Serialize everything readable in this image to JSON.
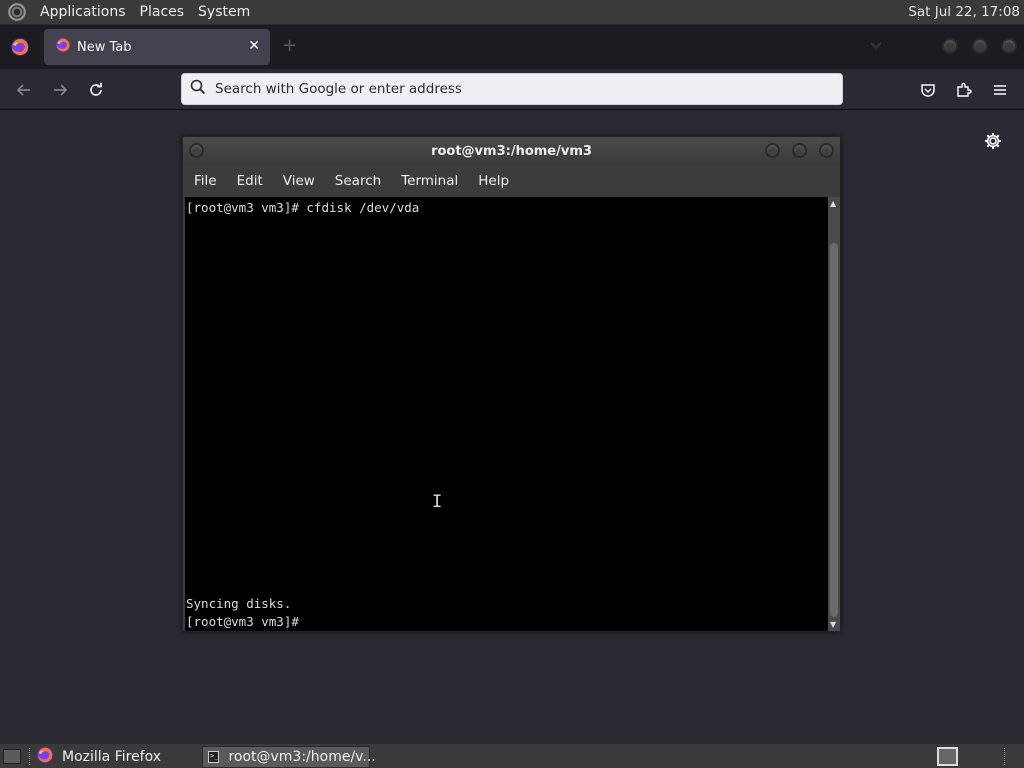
{
  "top_panel": {
    "menus": [
      "Applications",
      "Places",
      "System"
    ],
    "clock": "Sat Jul 22, 17:08"
  },
  "browser": {
    "tab": {
      "title": "New Tab",
      "close_glyph": "✕"
    },
    "newtab_glyph": "+",
    "urlbar": {
      "placeholder": "Search with Google or enter address"
    },
    "icons": [
      "firefox-icon",
      "back-arrow-icon",
      "forward-arrow-icon",
      "reload-icon",
      "search-icon",
      "pocket-icon",
      "extensions-icon",
      "hamburger-menu-icon",
      "gear-icon"
    ]
  },
  "terminal": {
    "title": "root@vm3:/home/vm3",
    "menus": [
      "File",
      "Edit",
      "View",
      "Search",
      "Terminal",
      "Help"
    ],
    "lines": [
      "[root@vm3 vm3]# cfdisk /dev/vda",
      "Syncing disks.",
      "[root@vm3 vm3]#"
    ]
  },
  "taskbar": {
    "items": [
      {
        "label": "Mozilla Firefox"
      },
      {
        "label": "root@vm3:/home/v..."
      }
    ]
  }
}
